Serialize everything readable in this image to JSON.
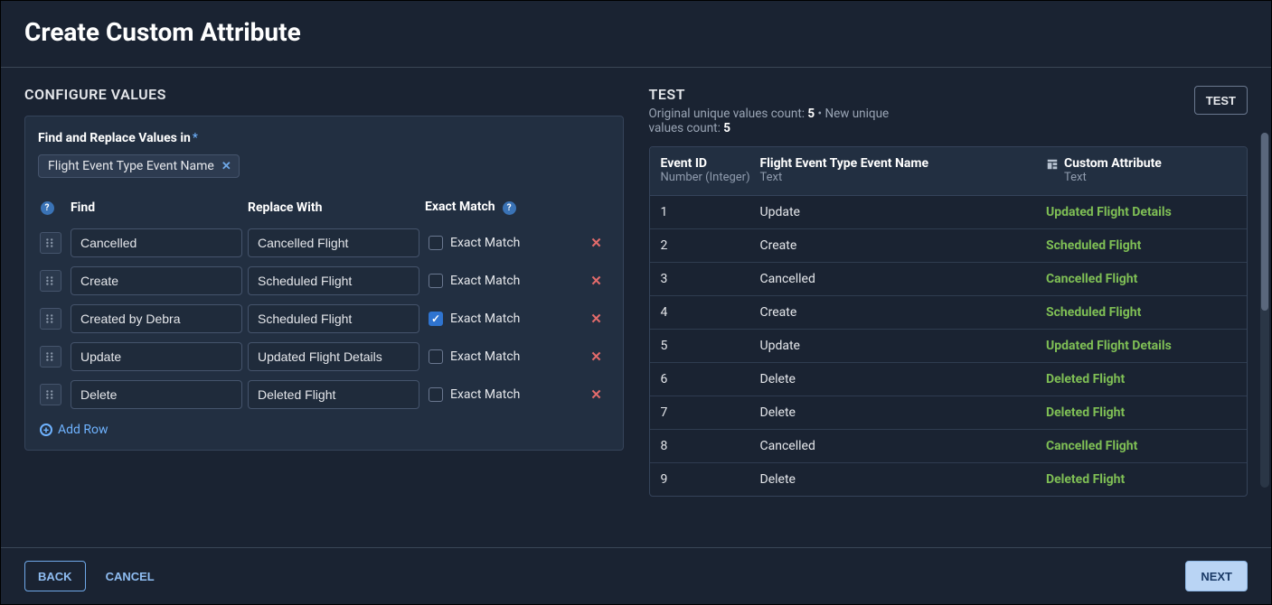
{
  "header": {
    "title": "Create Custom Attribute"
  },
  "configure": {
    "section_title": "CONFIGURE VALUES",
    "field_label": "Find and Replace Values in",
    "chip_label": "Flight Event Type Event Name",
    "columns": {
      "find": "Find",
      "replace": "Replace With",
      "exact": "Exact Match"
    },
    "exact_match_label": "Exact Match",
    "add_row_label": "Add Row",
    "rules": [
      {
        "find": "Cancelled",
        "replace": "Cancelled Flight",
        "exact": false
      },
      {
        "find": "Create",
        "replace": "Scheduled Flight",
        "exact": false
      },
      {
        "find": "Created by Debra",
        "replace": "Scheduled Flight",
        "exact": true
      },
      {
        "find": "Update",
        "replace": "Updated Flight Details",
        "exact": false
      },
      {
        "find": "Delete",
        "replace": "Deleted Flight",
        "exact": false
      }
    ]
  },
  "test": {
    "section_title": "TEST",
    "counts": {
      "prefix_original": "Original unique values count: ",
      "original": "5",
      "sep": " • ",
      "prefix_new": "New unique values count: ",
      "new_": "5"
    },
    "button_label": "TEST",
    "columns": {
      "event_id": {
        "title": "Event ID",
        "sub": "Number (Integer)"
      },
      "event_name": {
        "title": "Flight Event Type Event Name",
        "sub": "Text"
      },
      "custom": {
        "title": "Custom Attribute",
        "sub": "Text"
      }
    },
    "rows": [
      {
        "id": "1",
        "name": "Update",
        "custom": "Updated Flight Details"
      },
      {
        "id": "2",
        "name": "Create",
        "custom": "Scheduled Flight"
      },
      {
        "id": "3",
        "name": "Cancelled",
        "custom": "Cancelled Flight"
      },
      {
        "id": "4",
        "name": "Create",
        "custom": "Scheduled Flight"
      },
      {
        "id": "5",
        "name": "Update",
        "custom": "Updated Flight Details"
      },
      {
        "id": "6",
        "name": "Delete",
        "custom": "Deleted Flight"
      },
      {
        "id": "7",
        "name": "Delete",
        "custom": "Deleted Flight"
      },
      {
        "id": "8",
        "name": "Cancelled",
        "custom": "Cancelled Flight"
      },
      {
        "id": "9",
        "name": "Delete",
        "custom": "Deleted Flight"
      }
    ]
  },
  "footer": {
    "back": "BACK",
    "cancel": "CANCEL",
    "next": "NEXT"
  }
}
